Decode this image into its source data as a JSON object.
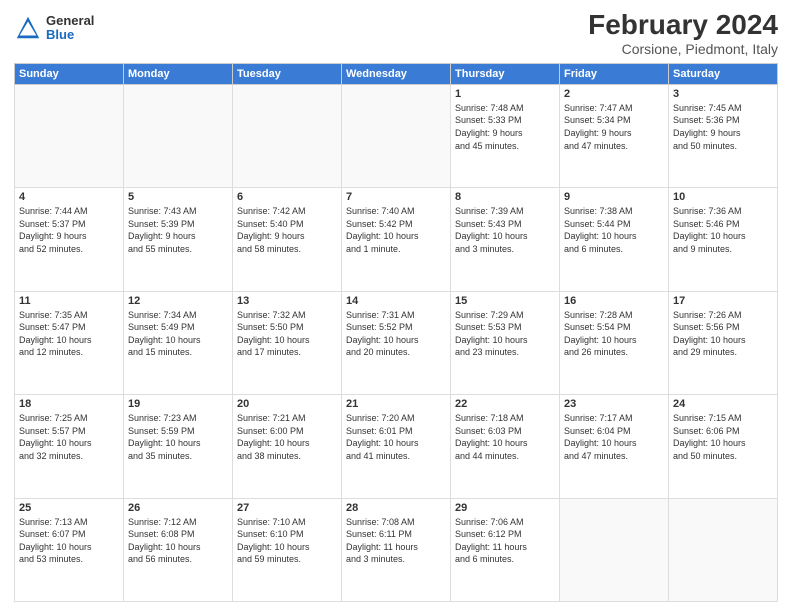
{
  "header": {
    "logo_general": "General",
    "logo_blue": "Blue",
    "title": "February 2024",
    "subtitle": "Corsione, Piedmont, Italy"
  },
  "weekdays": [
    "Sunday",
    "Monday",
    "Tuesday",
    "Wednesday",
    "Thursday",
    "Friday",
    "Saturday"
  ],
  "weeks": [
    [
      {
        "day": "",
        "info": ""
      },
      {
        "day": "",
        "info": ""
      },
      {
        "day": "",
        "info": ""
      },
      {
        "day": "",
        "info": ""
      },
      {
        "day": "1",
        "info": "Sunrise: 7:48 AM\nSunset: 5:33 PM\nDaylight: 9 hours\nand 45 minutes."
      },
      {
        "day": "2",
        "info": "Sunrise: 7:47 AM\nSunset: 5:34 PM\nDaylight: 9 hours\nand 47 minutes."
      },
      {
        "day": "3",
        "info": "Sunrise: 7:45 AM\nSunset: 5:36 PM\nDaylight: 9 hours\nand 50 minutes."
      }
    ],
    [
      {
        "day": "4",
        "info": "Sunrise: 7:44 AM\nSunset: 5:37 PM\nDaylight: 9 hours\nand 52 minutes."
      },
      {
        "day": "5",
        "info": "Sunrise: 7:43 AM\nSunset: 5:39 PM\nDaylight: 9 hours\nand 55 minutes."
      },
      {
        "day": "6",
        "info": "Sunrise: 7:42 AM\nSunset: 5:40 PM\nDaylight: 9 hours\nand 58 minutes."
      },
      {
        "day": "7",
        "info": "Sunrise: 7:40 AM\nSunset: 5:42 PM\nDaylight: 10 hours\nand 1 minute."
      },
      {
        "day": "8",
        "info": "Sunrise: 7:39 AM\nSunset: 5:43 PM\nDaylight: 10 hours\nand 3 minutes."
      },
      {
        "day": "9",
        "info": "Sunrise: 7:38 AM\nSunset: 5:44 PM\nDaylight: 10 hours\nand 6 minutes."
      },
      {
        "day": "10",
        "info": "Sunrise: 7:36 AM\nSunset: 5:46 PM\nDaylight: 10 hours\nand 9 minutes."
      }
    ],
    [
      {
        "day": "11",
        "info": "Sunrise: 7:35 AM\nSunset: 5:47 PM\nDaylight: 10 hours\nand 12 minutes."
      },
      {
        "day": "12",
        "info": "Sunrise: 7:34 AM\nSunset: 5:49 PM\nDaylight: 10 hours\nand 15 minutes."
      },
      {
        "day": "13",
        "info": "Sunrise: 7:32 AM\nSunset: 5:50 PM\nDaylight: 10 hours\nand 17 minutes."
      },
      {
        "day": "14",
        "info": "Sunrise: 7:31 AM\nSunset: 5:52 PM\nDaylight: 10 hours\nand 20 minutes."
      },
      {
        "day": "15",
        "info": "Sunrise: 7:29 AM\nSunset: 5:53 PM\nDaylight: 10 hours\nand 23 minutes."
      },
      {
        "day": "16",
        "info": "Sunrise: 7:28 AM\nSunset: 5:54 PM\nDaylight: 10 hours\nand 26 minutes."
      },
      {
        "day": "17",
        "info": "Sunrise: 7:26 AM\nSunset: 5:56 PM\nDaylight: 10 hours\nand 29 minutes."
      }
    ],
    [
      {
        "day": "18",
        "info": "Sunrise: 7:25 AM\nSunset: 5:57 PM\nDaylight: 10 hours\nand 32 minutes."
      },
      {
        "day": "19",
        "info": "Sunrise: 7:23 AM\nSunset: 5:59 PM\nDaylight: 10 hours\nand 35 minutes."
      },
      {
        "day": "20",
        "info": "Sunrise: 7:21 AM\nSunset: 6:00 PM\nDaylight: 10 hours\nand 38 minutes."
      },
      {
        "day": "21",
        "info": "Sunrise: 7:20 AM\nSunset: 6:01 PM\nDaylight: 10 hours\nand 41 minutes."
      },
      {
        "day": "22",
        "info": "Sunrise: 7:18 AM\nSunset: 6:03 PM\nDaylight: 10 hours\nand 44 minutes."
      },
      {
        "day": "23",
        "info": "Sunrise: 7:17 AM\nSunset: 6:04 PM\nDaylight: 10 hours\nand 47 minutes."
      },
      {
        "day": "24",
        "info": "Sunrise: 7:15 AM\nSunset: 6:06 PM\nDaylight: 10 hours\nand 50 minutes."
      }
    ],
    [
      {
        "day": "25",
        "info": "Sunrise: 7:13 AM\nSunset: 6:07 PM\nDaylight: 10 hours\nand 53 minutes."
      },
      {
        "day": "26",
        "info": "Sunrise: 7:12 AM\nSunset: 6:08 PM\nDaylight: 10 hours\nand 56 minutes."
      },
      {
        "day": "27",
        "info": "Sunrise: 7:10 AM\nSunset: 6:10 PM\nDaylight: 10 hours\nand 59 minutes."
      },
      {
        "day": "28",
        "info": "Sunrise: 7:08 AM\nSunset: 6:11 PM\nDaylight: 11 hours\nand 3 minutes."
      },
      {
        "day": "29",
        "info": "Sunrise: 7:06 AM\nSunset: 6:12 PM\nDaylight: 11 hours\nand 6 minutes."
      },
      {
        "day": "",
        "info": ""
      },
      {
        "day": "",
        "info": ""
      }
    ]
  ]
}
